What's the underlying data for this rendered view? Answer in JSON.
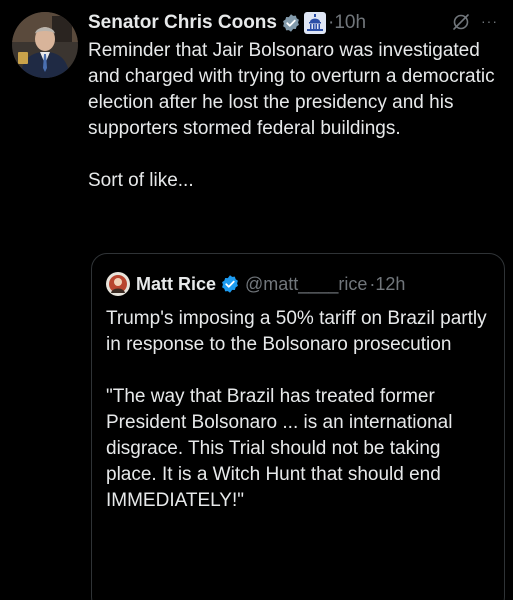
{
  "tweet": {
    "author_name": "Senator Chris Coons",
    "time": "10h",
    "separator": "·",
    "more_glyph": "···",
    "paragraphs": [
      "Reminder that Jair Bolsonaro was investigated and charged with trying to overturn a democratic election after he lost the presidency and his supporters stormed federal buildings.",
      "Sort of like..."
    ]
  },
  "quote": {
    "author_name": "Matt Rice",
    "handle": "@matt____rice",
    "time": "12h",
    "separator": "·",
    "paragraphs": [
      "Trump's imposing a 50% tariff on Brazil partly in response to the Bolsonaro prosecution",
      "\"The way that Brazil has treated former President Bolsonaro ... is an international disgrace. This Trial should not be taking place. It is a Witch Hunt that should end IMMEDIATELY!\""
    ]
  },
  "colors": {
    "background": "#000000",
    "text_primary": "#e7e9ea",
    "text_secondary": "#71767b",
    "verified_blue": "#1d9bf0",
    "border": "#2f3336"
  },
  "icons": {
    "verified": "verified-badge-icon",
    "government": "capitol-building-icon",
    "grok": "grok-icon",
    "more": "more-options-icon"
  }
}
